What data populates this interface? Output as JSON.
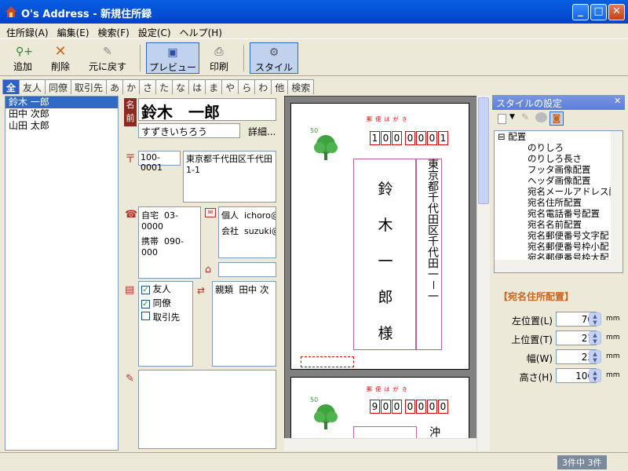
{
  "window": {
    "title": "O's Address - 新規住所録"
  },
  "menu": [
    "住所録(A)",
    "編集(E)",
    "検索(F)",
    "設定(C)",
    "ヘルプ(H)"
  ],
  "toolbar": {
    "add": "追加",
    "delete": "削除",
    "undo": "元に戻す",
    "preview": "プレビュー",
    "print": "印刷",
    "style": "スタイル"
  },
  "tabs": [
    "全",
    "友人",
    "同僚",
    "取引先",
    "あ",
    "か",
    "さ",
    "た",
    "な",
    "は",
    "ま",
    "や",
    "ら",
    "わ",
    "他",
    "検索"
  ],
  "names": [
    "鈴木 一郎",
    "田中 次郎",
    "山田 太郎"
  ],
  "record": {
    "name_badge": "名前",
    "name": "鈴木　一郎",
    "furigana": "すずきいちろう",
    "detail_btn": "詳細...",
    "postal": "100-0001",
    "address": "東京都千代田区千代田1-1",
    "phones": [
      {
        "label": "自宅",
        "value": "03-0000"
      },
      {
        "label": "携帯",
        "value": "090-000"
      }
    ],
    "emails": [
      {
        "label": "個人",
        "value": "ichoro@"
      },
      {
        "label": "会社",
        "value": "suzuki@"
      }
    ],
    "groups": [
      {
        "label": "友人",
        "checked": true
      },
      {
        "label": "同僚",
        "checked": true
      },
      {
        "label": "取引先",
        "checked": false
      }
    ],
    "relation": {
      "label": "親類",
      "value": "田中 次"
    }
  },
  "preview": {
    "card_label": "郵 便 は が き",
    "stamp_value": "50",
    "postal_digits_1": [
      "1",
      "0",
      "0",
      "0",
      "0",
      "0",
      "1"
    ],
    "postal_digits_2": [
      "9",
      "0",
      "0",
      "0",
      "0",
      "0",
      "0"
    ],
    "address_vertical": "東京都千代田区千代田一－一",
    "address_vertical_2": "沖縄",
    "name_chars": [
      "鈴",
      "木",
      "一",
      "郎",
      "様"
    ]
  },
  "style_panel": {
    "title": "スタイルの設定",
    "tree": [
      "配置",
      "のりしろ",
      "のりしろ長さ",
      "フッタ画像配置",
      "ヘッダ画像配置",
      "宛名メールアドレス配",
      "宛名住所配置",
      "宛名電話番号配置",
      "宛名名前配置",
      "宛名郵便番号文字配",
      "宛名郵便番号枠小配",
      "宛名郵便番号枠大配"
    ],
    "section_title": "【宛名住所配置】",
    "fields": [
      {
        "label": "左位置(L)",
        "value": "70",
        "unit": "mm"
      },
      {
        "label": "上位置(T)",
        "value": "27",
        "unit": "mm"
      },
      {
        "label": "幅(W)",
        "value": "23",
        "unit": "mm"
      },
      {
        "label": "高さ(H)",
        "value": "106",
        "unit": "mm"
      }
    ]
  },
  "status": {
    "count": "3件中 3件"
  },
  "colors": {
    "titlebar": "#0553d8",
    "selection": "#316ac5",
    "postal_red": "#dd0000",
    "accent_red": "#b3322a"
  }
}
